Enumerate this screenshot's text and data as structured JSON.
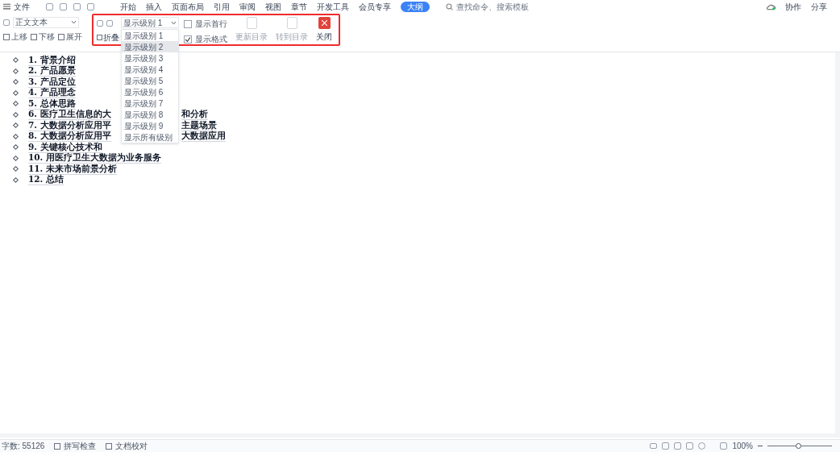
{
  "menu_bar": {
    "file": "文件",
    "tabs": [
      {
        "label": "开始",
        "selected": false
      },
      {
        "label": "插入",
        "selected": false
      },
      {
        "label": "页面布局",
        "selected": false
      },
      {
        "label": "引用",
        "selected": false
      },
      {
        "label": "审阅",
        "selected": false
      },
      {
        "label": "视图",
        "selected": false
      },
      {
        "label": "章节",
        "selected": false
      },
      {
        "label": "开发工具",
        "selected": false
      },
      {
        "label": "会员专享",
        "selected": false
      },
      {
        "label": "大纲",
        "selected": true
      }
    ],
    "search": {
      "placeholder": "查找命令、搜索模板"
    },
    "right": [
      "协作",
      "分享"
    ]
  },
  "toolbar": {
    "style_select": "正文文本",
    "level_select": "显示级别 1",
    "show_first_line": {
      "label": "显示首行",
      "checked": false
    },
    "show_format": {
      "label": "显示格式",
      "checked": true
    },
    "actions": [
      {
        "label": "更新目录",
        "disabled": true
      },
      {
        "label": "转到目录",
        "disabled": true
      },
      {
        "label": "关闭",
        "disabled": false
      }
    ],
    "moves": [
      "上移",
      "下移",
      "展开",
      "折叠"
    ]
  },
  "level_menu": [
    {
      "label": "显示级别 1",
      "selected": false
    },
    {
      "label": "显示级别 2",
      "selected": true
    },
    {
      "label": "显示级别 3",
      "selected": false
    },
    {
      "label": "显示级别 4",
      "selected": false
    },
    {
      "label": "显示级别 5",
      "selected": false
    },
    {
      "label": "显示级别 6",
      "selected": false
    },
    {
      "label": "显示级别 7",
      "selected": false
    },
    {
      "label": "显示级别 8",
      "selected": false
    },
    {
      "label": "显示级别 9",
      "selected": false
    },
    {
      "label": "显示所有级别",
      "selected": false
    }
  ],
  "outline": [
    {
      "parts": [
        "1. 背景介绍"
      ]
    },
    {
      "parts": [
        "2. 产品愿景"
      ]
    },
    {
      "parts": [
        "3. 产品定位"
      ]
    },
    {
      "parts": [
        "4. 产品理念"
      ]
    },
    {
      "parts": [
        "5. 总体思路"
      ]
    },
    {
      "parts": [
        "6. 医疗卫生信息的大",
        "和分析"
      ]
    },
    {
      "parts": [
        "7. 大数据分析应用平",
        "主题场景"
      ]
    },
    {
      "parts": [
        "8. 大数据分析应用平",
        "大数据应用"
      ]
    },
    {
      "parts": [
        "9. 关键核心技术和"
      ]
    },
    {
      "parts": [
        "10. 用医疗卫生大数据为业务服务"
      ]
    },
    {
      "parts": [
        "11. 未来市场前景分析"
      ]
    },
    {
      "parts": [
        "12. 总结"
      ]
    }
  ],
  "status_bar": {
    "word_count": "字数: 55126",
    "spell_check": "拼写检查",
    "proofread": "文档校对",
    "zoom": "100%",
    "zoom_slider": {
      "level": 0.48
    }
  }
}
